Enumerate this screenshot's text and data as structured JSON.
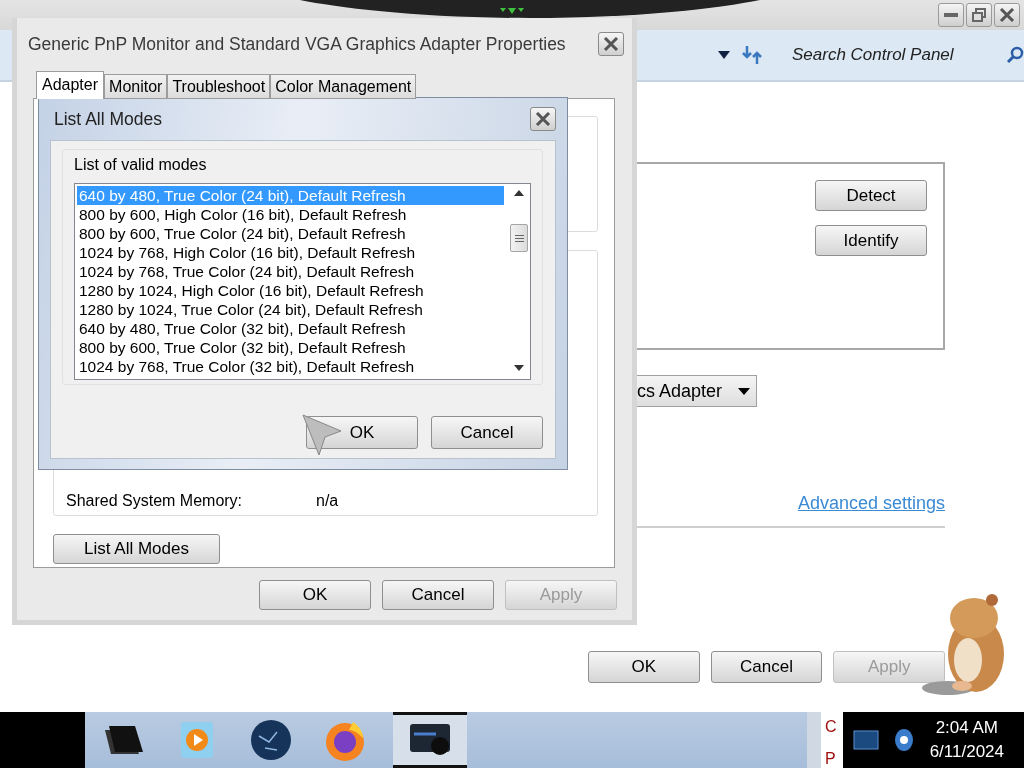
{
  "control_panel": {
    "search": {
      "placeholder": "Search Control Panel"
    },
    "display_buttons": [
      {
        "label": "Detect"
      },
      {
        "label": "Identify"
      }
    ],
    "adapter_dropdown": {
      "value": "cs Adapter"
    },
    "link": "Advanced settings",
    "footer_buttons": [
      {
        "label": "OK",
        "disabled": false
      },
      {
        "label": "Cancel",
        "disabled": false
      },
      {
        "label": "Apply",
        "disabled": true
      }
    ]
  },
  "properties_dialog": {
    "title": "Generic PnP Monitor and Standard VGA Graphics Adapter Properties",
    "tabs": [
      {
        "label": "Adapter",
        "selected": true
      },
      {
        "label": "Monitor",
        "selected": false
      },
      {
        "label": "Troubleshoot",
        "selected": false
      },
      {
        "label": "Color Management",
        "selected": false
      }
    ],
    "memory_row": {
      "label": "Shared System Memory:",
      "value": "n/a"
    },
    "list_modes_button": "List All Modes",
    "buttons": [
      {
        "label": "OK",
        "disabled": false
      },
      {
        "label": "Cancel",
        "disabled": false
      },
      {
        "label": "Apply",
        "disabled": true
      }
    ]
  },
  "modes_dialog": {
    "title": "List All Modes",
    "group_label": "List of valid modes",
    "modes": [
      {
        "label": "640 by 480, True Color (24 bit), Default Refresh",
        "selected": true
      },
      {
        "label": "800 by 600, High Color (16 bit), Default Refresh",
        "selected": false
      },
      {
        "label": "800 by 600, True Color (24 bit), Default Refresh",
        "selected": false
      },
      {
        "label": "1024 by 768, High Color (16 bit), Default Refresh",
        "selected": false
      },
      {
        "label": "1024 by 768, True Color (24 bit), Default Refresh",
        "selected": false
      },
      {
        "label": "1280 by 1024, High Color (16 bit), Default Refresh",
        "selected": false
      },
      {
        "label": "1280 by 1024, True Color (24 bit), Default Refresh",
        "selected": false
      },
      {
        "label": "640 by 480, True Color (32 bit), Default Refresh",
        "selected": false
      },
      {
        "label": "800 by 600, True Color (32 bit), Default Refresh",
        "selected": false
      },
      {
        "label": "1024 by 768, True Color (32 bit), Default Refresh",
        "selected": false
      }
    ],
    "buttons": [
      {
        "label": "OK"
      },
      {
        "label": "Cancel"
      }
    ]
  },
  "taskbar": {
    "apps": [
      {
        "kind": "folder",
        "active": false
      },
      {
        "kind": "player",
        "active": false
      },
      {
        "kind": "globe",
        "active": false
      },
      {
        "kind": "browser",
        "active": false
      },
      {
        "kind": "display",
        "active": true
      }
    ],
    "tray_text": [
      "C",
      "P"
    ],
    "time": "2:04 AM",
    "date": "6/11/2024"
  }
}
